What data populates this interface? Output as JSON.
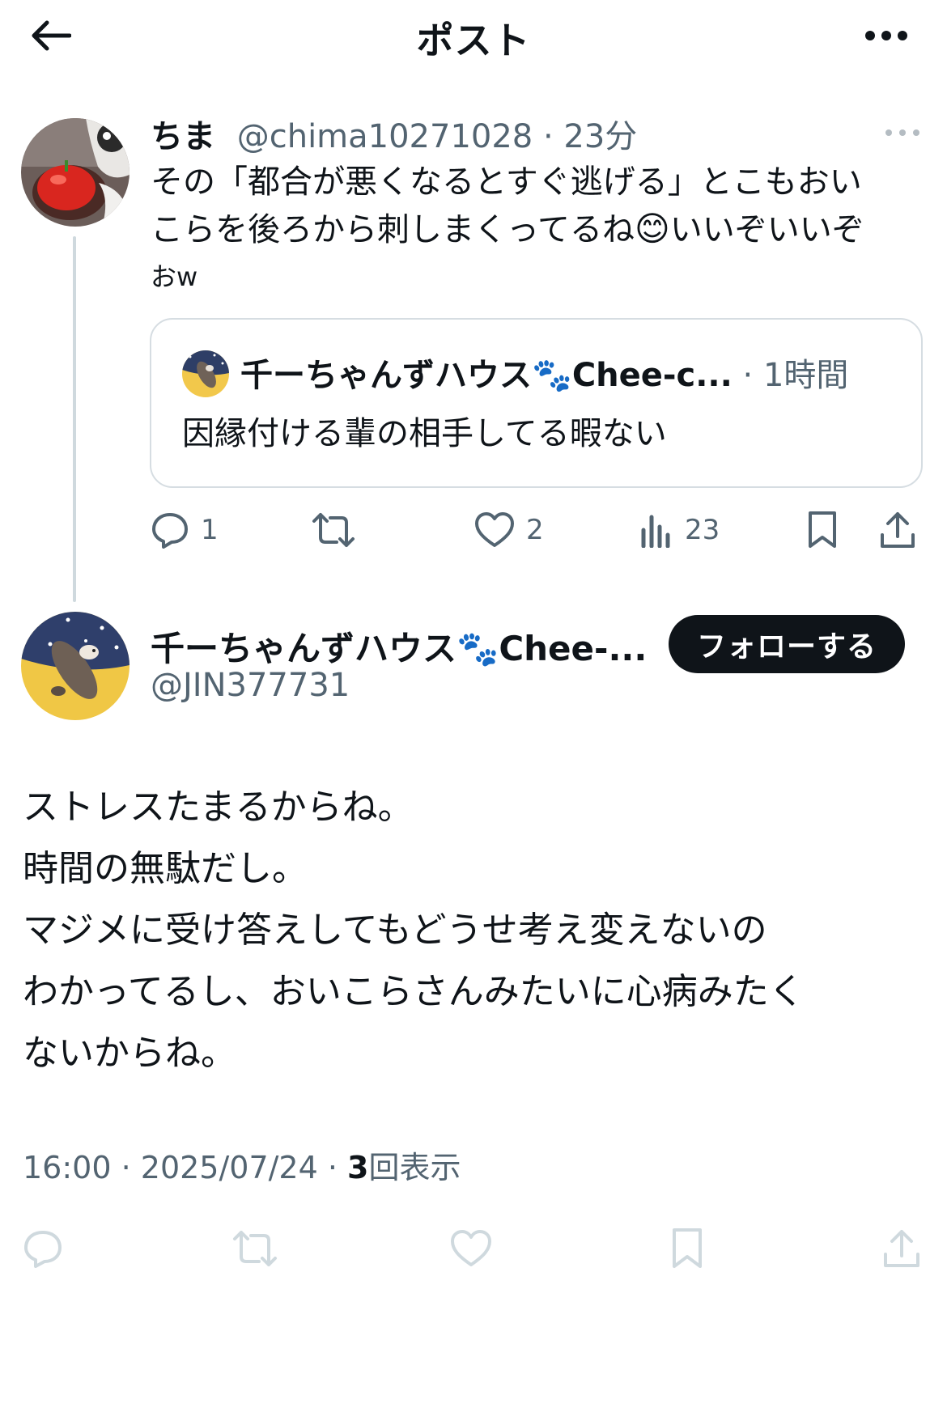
{
  "header": {
    "title": "ポスト"
  },
  "parent_tweet": {
    "name": "ちま",
    "handle": "@chima10271028",
    "separator": " · ",
    "time": "23分",
    "text_line1": "その「都合が悪くなるとすぐ逃げる」とこもおい",
    "text_line2a": "こらを後ろから刺しまくってるね",
    "emoji": "😊",
    "text_line2b": "いいぞいいぞ",
    "text_line3": "おw",
    "quote": {
      "name": "千ーちゃんずハウス",
      "paw": "🐾",
      "name_tail": "Chee-c...",
      "separator": " · ",
      "time": "1時間",
      "text": "因縁付ける輩の相手してる暇ない"
    },
    "stats": {
      "replies": "1",
      "likes": "2",
      "views": "23"
    }
  },
  "main_tweet": {
    "name": "千ーちゃんずハウス",
    "paw": "🐾",
    "name_tail": "Chee-...",
    "handle": "@JIN377731",
    "follow_label": "フォローする",
    "body": [
      "ストレスたまるからね。",
      "時間の無駄だし。",
      "マジメに受け答えしてもどうせ考え変えないの",
      "わかってるし、おいこらさんみたいに心病みたく",
      "ないからね。"
    ],
    "time": "16:00",
    "date": "2025/07/24",
    "separator": " · ",
    "view_count": "3",
    "view_label": "回表示"
  },
  "colors": {
    "text": "#0f1419",
    "muted": "#536471",
    "border": "#cfd9de",
    "action_idle": "#cfd9de"
  },
  "icons": [
    "back-arrow-icon",
    "more-icon",
    "reply-icon",
    "retweet-icon",
    "like-icon",
    "views-icon",
    "bookmark-icon",
    "share-icon"
  ]
}
